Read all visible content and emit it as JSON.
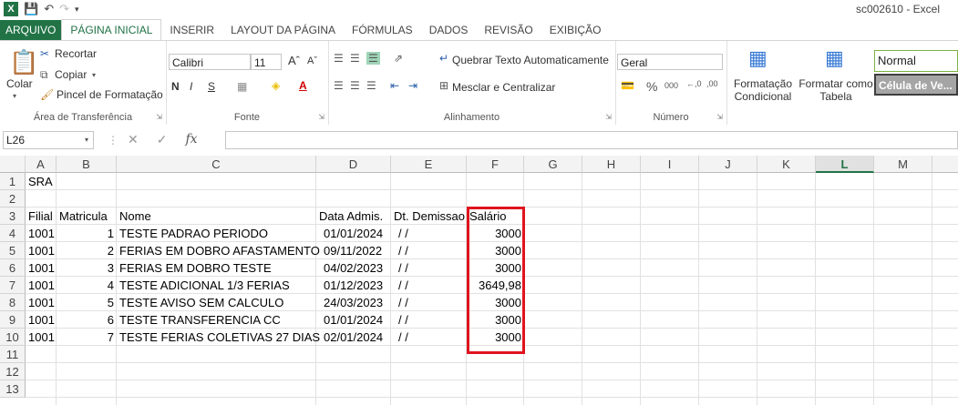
{
  "window": {
    "title": "sc002610 - Excel"
  },
  "tabs": [
    "ARQUIVO",
    "PÁGINA INICIAL",
    "INSERIR",
    "LAYOUT DA PÁGINA",
    "FÓRMULAS",
    "DADOS",
    "REVISÃO",
    "EXIBIÇÃO"
  ],
  "ribbon": {
    "clipboard": {
      "paste": "Colar",
      "cut": "Recortar",
      "copy": "Copiar",
      "format_painter": "Pincel de Formatação",
      "label": "Área de Transferência"
    },
    "font": {
      "name": "Calibri",
      "size": "11",
      "label": "Fonte",
      "bold": "N",
      "italic": "I",
      "underline": "S"
    },
    "alignment": {
      "wrap": "Quebrar Texto Automaticamente",
      "merge": "Mesclar e Centralizar",
      "label": "Alinhamento"
    },
    "number": {
      "format": "Geral",
      "label": "Número"
    },
    "styles": {
      "conditional": "Formatação Condicional",
      "table": "Formatar como Tabela",
      "normal": "Normal",
      "check": "Célula de Ve..."
    }
  },
  "formula_bar": {
    "name_box": "L26",
    "fx": "fx",
    "value": ""
  },
  "columns": [
    "A",
    "B",
    "C",
    "D",
    "E",
    "F",
    "G",
    "H",
    "I",
    "J",
    "K",
    "L",
    "M"
  ],
  "selected_column": "L",
  "rows": [
    "1",
    "2",
    "3",
    "4",
    "5",
    "6",
    "7",
    "8",
    "9",
    "10",
    "11",
    "12",
    "13"
  ],
  "sheet": {
    "a1": "SRA",
    "headers": {
      "filial": "Filial",
      "matricula": "Matricula",
      "nome": "Nome",
      "data_adm": "Data Admis.",
      "dt_dem": "Dt. Demissao",
      "salario": "Salário"
    },
    "records": [
      {
        "filial": "1001",
        "matricula": "1",
        "nome": "TESTE PADRAO PERIODO",
        "data_adm": "01/01/2024",
        "dt_dem": "/  /",
        "salario": "3000"
      },
      {
        "filial": "1001",
        "matricula": "2",
        "nome": "FERIAS EM DOBRO AFASTAMENTO",
        "data_adm": "09/11/2022",
        "dt_dem": "/  /",
        "salario": "3000"
      },
      {
        "filial": "1001",
        "matricula": "3",
        "nome": "FERIAS EM DOBRO TESTE",
        "data_adm": "04/02/2023",
        "dt_dem": "/  /",
        "salario": "3000"
      },
      {
        "filial": "1001",
        "matricula": "4",
        "nome": "TESTE ADICIONAL 1/3 FERIAS",
        "data_adm": "01/12/2023",
        "dt_dem": "/  /",
        "salario": "3649,98"
      },
      {
        "filial": "1001",
        "matricula": "5",
        "nome": "TESTE AVISO SEM CALCULO",
        "data_adm": "24/03/2023",
        "dt_dem": "/  /",
        "salario": "3000"
      },
      {
        "filial": "1001",
        "matricula": "6",
        "nome": "TESTE TRANSFERENCIA CC",
        "data_adm": "01/01/2024",
        "dt_dem": "/  /",
        "salario": "3000"
      },
      {
        "filial": "1001",
        "matricula": "7",
        "nome": "TESTE FERIAS COLETIVAS 27 DIAS",
        "data_adm": "02/01/2024",
        "dt_dem": "/  /",
        "salario": "3000"
      }
    ]
  },
  "colors": {
    "accent": "#217346",
    "highlight": "#e0141e"
  }
}
